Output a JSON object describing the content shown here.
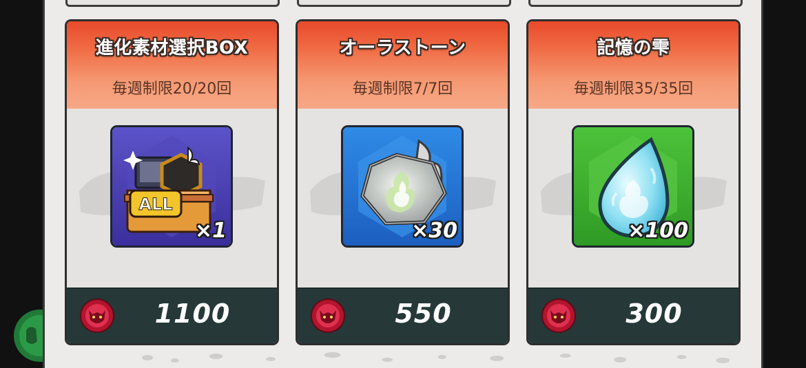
{
  "colors": {
    "header_top": "#e84a2a",
    "header_bottom": "#f7a887",
    "footer_bg": "#263838",
    "card_bg": "#e4e3e1",
    "limit_text": "#5a3426"
  },
  "shop_items": [
    {
      "title": "進化素材選択BOX",
      "limit": "毎週制限20/20回",
      "icon": "all-evolution-box-icon",
      "icon_bg": "#4a3fb0",
      "quantity": "×1",
      "currency_icon": "red-demon-coin-icon",
      "price": "1100"
    },
    {
      "title": "オーラストーン",
      "limit": "毎週制限7/7回",
      "icon": "aura-stone-icon",
      "icon_bg": "#2a7fd8",
      "quantity": "×30",
      "currency_icon": "red-demon-coin-icon",
      "price": "550"
    },
    {
      "title": "記憶の雫",
      "limit": "毎週制限35/35回",
      "icon": "memory-drop-icon",
      "icon_bg": "#3fb22e",
      "quantity": "×100",
      "currency_icon": "red-demon-coin-icon",
      "price": "300"
    }
  ]
}
